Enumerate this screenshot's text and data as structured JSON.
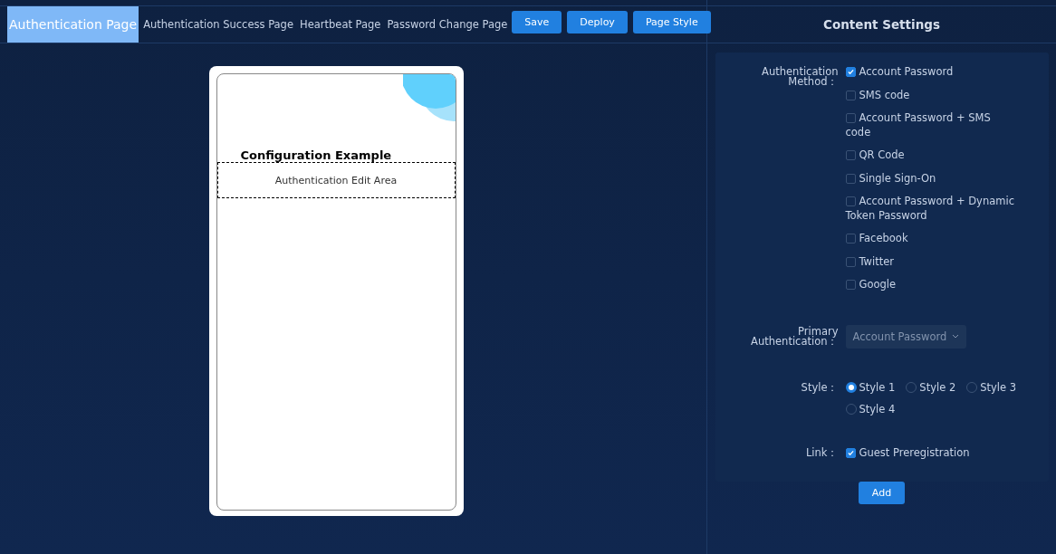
{
  "tabs": [
    {
      "label": "Authentication Page",
      "selected": true
    },
    {
      "label": "Authentication Success Page",
      "selected": false
    },
    {
      "label": "Heartbeat Page",
      "selected": false
    },
    {
      "label": "Password Change Page",
      "selected": false
    }
  ],
  "actions": [
    "Save",
    "Deploy",
    "Page Style"
  ],
  "preview": {
    "title": "Configuration Example",
    "edit_area": "Authentication Edit Area"
  },
  "settings": {
    "title": "Content Settings",
    "method_label": "Authentication Method：",
    "methods": [
      {
        "label": "Account Password",
        "checked": true
      },
      {
        "label": "SMS code",
        "checked": false
      },
      {
        "label": "Account Password + SMS code",
        "checked": false
      },
      {
        "label": "QR Code",
        "checked": false
      },
      {
        "label": "Single Sign-On",
        "checked": false
      },
      {
        "label": "Account Password + Dynamic Token Password",
        "checked": false
      },
      {
        "label": "Facebook",
        "checked": false
      },
      {
        "label": "Twitter",
        "checked": false
      },
      {
        "label": "Google",
        "checked": false
      }
    ],
    "primary_label": "Primary Authentication：",
    "primary_value": "Account Password",
    "style_label": "Style：",
    "styles": [
      {
        "label": "Style 1",
        "selected": true
      },
      {
        "label": "Style 2",
        "selected": false
      },
      {
        "label": "Style 3",
        "selected": false
      },
      {
        "label": "Style 4",
        "selected": false
      }
    ],
    "link_label": "Link：",
    "links": [
      {
        "label": "Guest Preregistration",
        "checked": true
      }
    ],
    "add_button": "Add"
  }
}
